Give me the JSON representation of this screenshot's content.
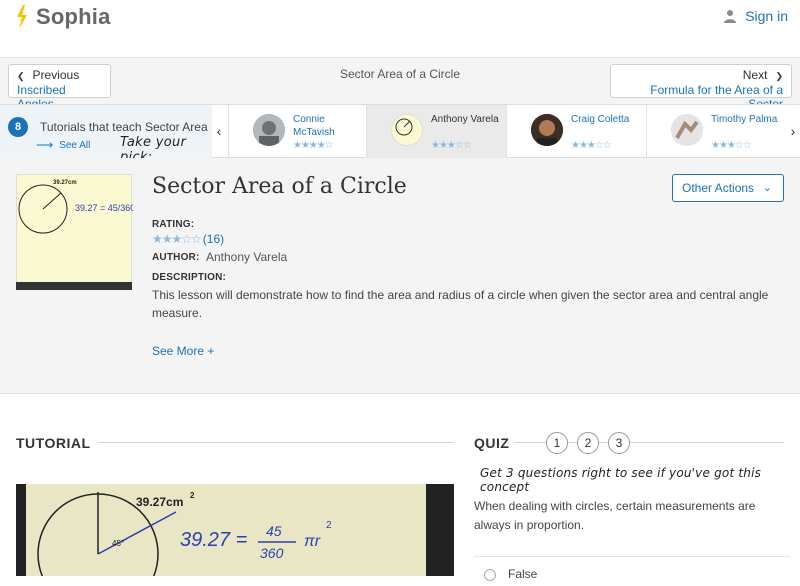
{
  "header": {
    "brand": "Sophia",
    "signin_label": "Sign in"
  },
  "nav": {
    "prev_small": "Previous",
    "prev_big": "Inscribed Angles",
    "center_title": "Sector Area of a Circle",
    "next_small": "Next",
    "next_big": "Formula for the Area of a Sector"
  },
  "tutorials": {
    "count": "8",
    "label": "Tutorials that teach Sector Area",
    "see_all": "See All",
    "pick": "Take your pick:",
    "authors": [
      {
        "name": "Connie McTavish",
        "stars": "★★★★☆"
      },
      {
        "name": "Anthony Varela",
        "stars": "★★★☆☆"
      },
      {
        "name": "Craig Coletta",
        "stars": "★★★☆☆"
      },
      {
        "name": "Timothy Palma",
        "stars": "★★★☆☆"
      }
    ]
  },
  "lesson": {
    "title": "Sector Area of a Circle",
    "actions_label": "Other Actions",
    "rating_label": "RATING:",
    "rating_stars": "★★★☆☆",
    "rating_count": "(16)",
    "author_label": "AUTHOR:",
    "author": "Anthony Varela",
    "description_label": "DESCRIPTION:",
    "description": "This lesson will demonstrate how to find the area and radius of a circle when given the sector area and central angle measure.",
    "see_more": "See More +",
    "thumb_area": "39.27cm",
    "thumb_eq": "39.27 = 45/360",
    "video_area": "39.27cm",
    "video_eq_left": "39.27 =",
    "video_frac_top": "45",
    "video_frac_bottom": "360",
    "video_pi": "πr",
    "video_angle": "45°"
  },
  "tutorial_section": {
    "heading": "TUTORIAL"
  },
  "quiz": {
    "heading": "QUIZ",
    "steps": [
      "1",
      "2",
      "3"
    ],
    "hint": "Get 3 questions right to see if you've got this concept",
    "question": "When dealing with circles, certain measurements are always in proportion.",
    "answers": [
      "False"
    ]
  },
  "colors": {
    "accent": "#1a73b8",
    "logo_yellow": "#f5c400",
    "star": "#8fb8dd"
  }
}
